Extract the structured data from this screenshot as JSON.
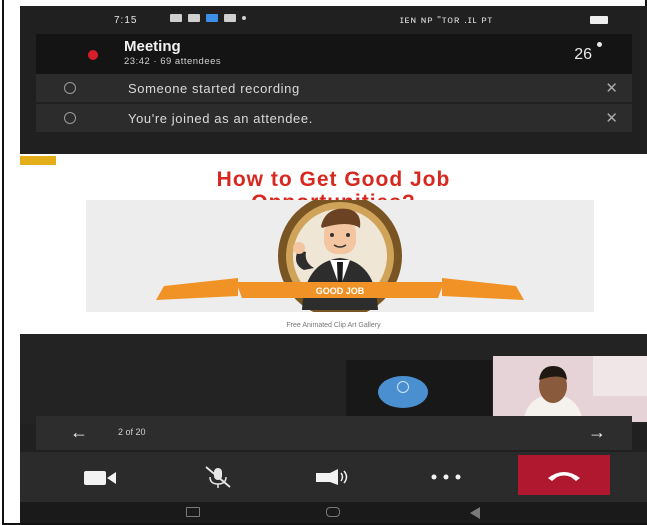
{
  "status_bar": {
    "time": "7:15",
    "system_text": "ɪᴇɴ ɴᴘ \"ᴛᴏʀ .ɪʟ ᴘᴛ"
  },
  "meeting": {
    "title": "Meeting",
    "subtitle": "23:42 · 69 attendees",
    "participants_count": "26"
  },
  "notifications": [
    {
      "text": "Someone started recording",
      "close": "✕"
    },
    {
      "text": "You're joined as an attendee.",
      "close": "✕"
    }
  ],
  "slide": {
    "title_line1": "How to Get Good Job",
    "title_line2": "Opportunities?",
    "banner_text": "GOOD JOB",
    "caption": "Free Animated Clip Art Gallery"
  },
  "pager": {
    "page_text": "2 of 20",
    "prev": "←",
    "next": "→"
  },
  "colors": {
    "accent_red": "#d7281f",
    "hangup": "#b0182f",
    "avatar_blue": "#4a8fcf",
    "banner_orange": "#f09225"
  },
  "icons": {
    "video": "video-camera-icon",
    "mic": "microphone-muted-icon",
    "speaker": "speaker-icon",
    "more": "more-dots-icon",
    "hangup": "hang-up-icon"
  }
}
